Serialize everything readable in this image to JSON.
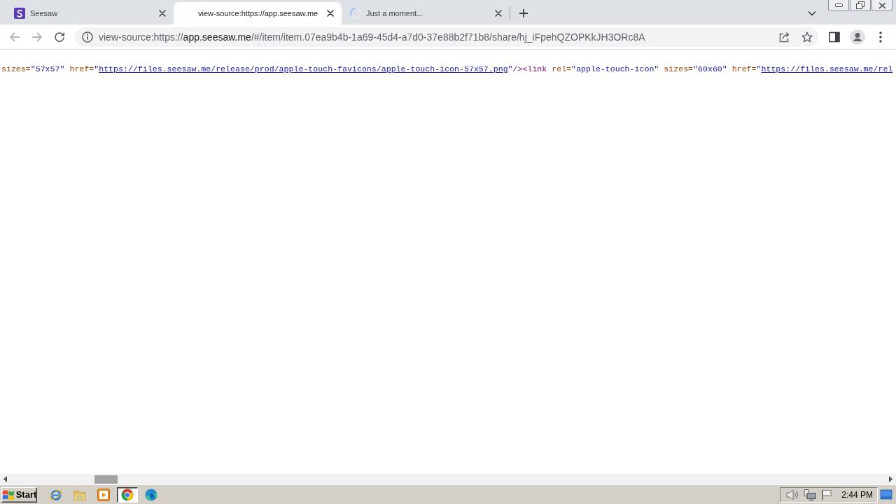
{
  "tabs": [
    {
      "kind": "favicon",
      "title": "Seesaw",
      "selected": false
    },
    {
      "kind": "none",
      "title": "view-source:https://app.seesaw.me",
      "selected": true
    },
    {
      "kind": "loading",
      "title": "Just a moment...",
      "selected": false
    }
  ],
  "toolbar": {
    "nav": [
      {
        "kind": "back",
        "disabled": true
      },
      {
        "kind": "forward",
        "disabled": true
      },
      {
        "kind": "reload",
        "disabled": false
      }
    ]
  },
  "address_bar": {
    "scheme": "view-source:https://",
    "host": "app.seesaw.me",
    "path": "/#/item/item.07ea9b4b-1a69-45d4-a7d0-37e88b2f71b8/share/hj_iFpehQZOPKkJH3ORc8A"
  },
  "source_line": [
    {
      "kind": "attr_name",
      "text": "sizes="
    },
    {
      "kind": "attr_value",
      "text": "\"57x57\""
    },
    {
      "kind": "attr_name",
      "text": "href="
    },
    {
      "kind": "attr_value",
      "text": "\""
    },
    {
      "kind": "link",
      "text": "https://files.seesaw.me/release/prod/apple-touch-favicons/apple-touch-icon-57x57.png"
    },
    {
      "kind": "attr_value",
      "text": "\""
    },
    {
      "kind": "tag",
      "text": "/><link"
    },
    {
      "kind": "attr_name",
      "text": "rel="
    },
    {
      "kind": "attr_value",
      "text": "\"apple-touch-icon\""
    },
    {
      "kind": "attr_name",
      "text": "sizes="
    },
    {
      "kind": "attr_value",
      "text": "\"60x60\""
    },
    {
      "kind": "attr_name",
      "text": "href="
    },
    {
      "kind": "attr_value",
      "text": "\""
    },
    {
      "kind": "link",
      "text": "https://files.seesaw.me/rel"
    }
  ],
  "taskbar": {
    "start": "Start",
    "apps": [
      {
        "kind": "ie",
        "selected": false
      },
      {
        "kind": "explorer",
        "selected": false
      },
      {
        "kind": "media_player",
        "selected": false
      },
      {
        "kind": "chrome",
        "selected": true
      },
      {
        "kind": "edge",
        "selected": false
      }
    ],
    "clock": "2:44 PM"
  }
}
